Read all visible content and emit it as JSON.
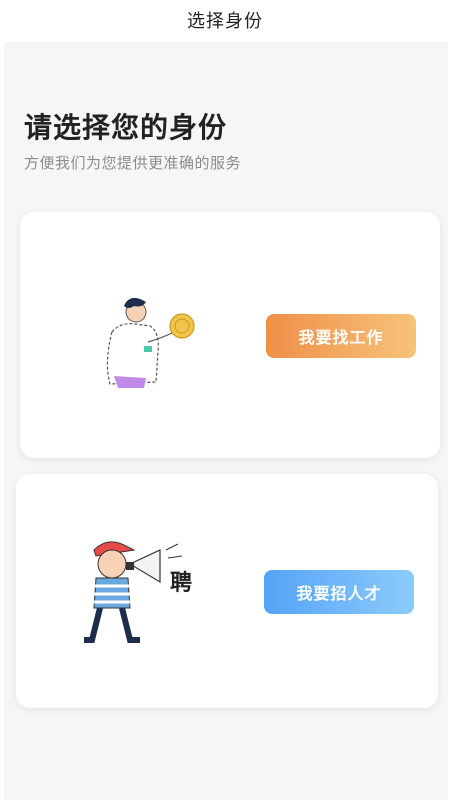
{
  "nav": {
    "title": "选择身份"
  },
  "heading": {
    "title": "请选择您的身份",
    "subtitle": "方便我们为您提供更准确的服务"
  },
  "cards": [
    {
      "button_label": "我要找工作",
      "illustration": "job-seeker-illustration",
      "accent": "#ef8f48"
    },
    {
      "button_label": "我要招人才",
      "illustration": "recruiter-megaphone-illustration",
      "accent": "#55a3f6",
      "illustration_text": "聘"
    }
  ]
}
